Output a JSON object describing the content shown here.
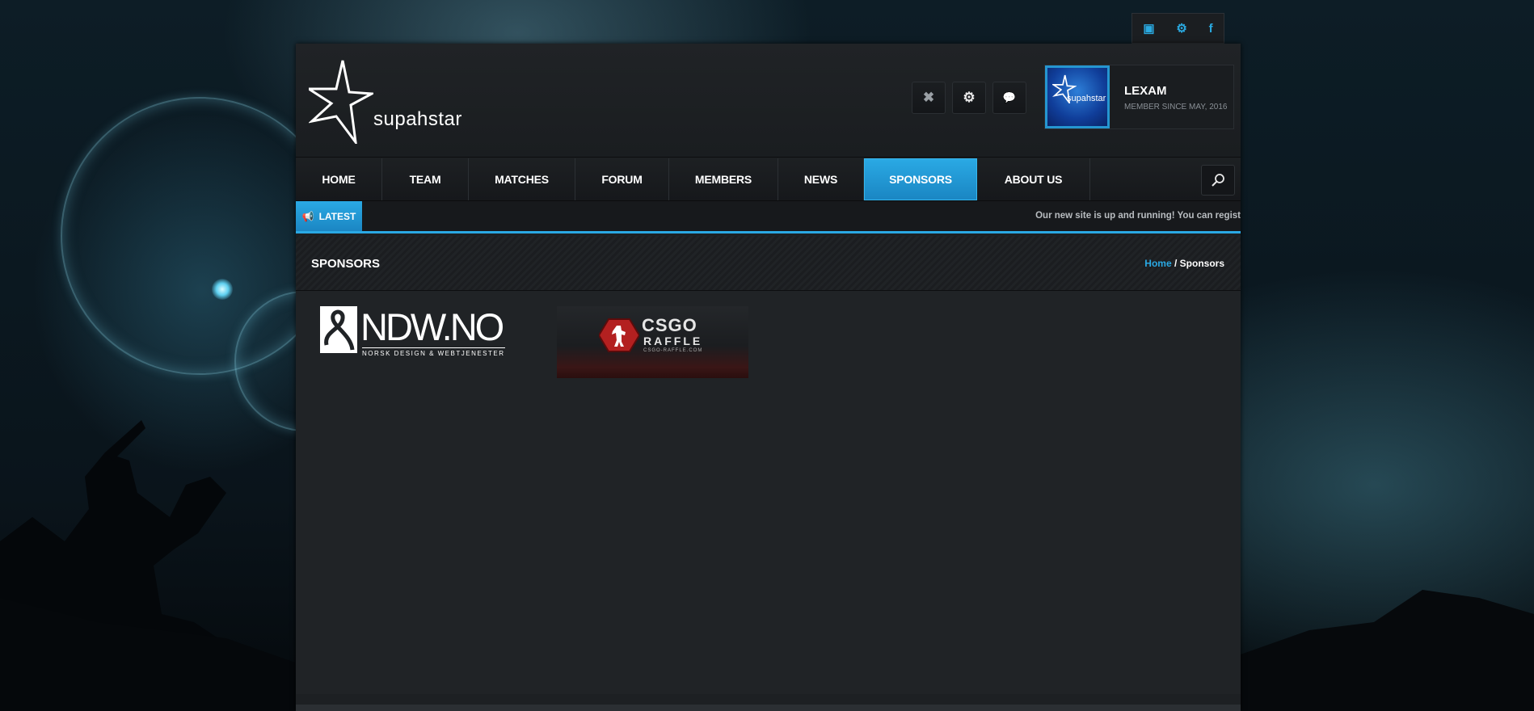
{
  "social": {
    "items": [
      {
        "icon": "twitch-icon",
        "glyph": "▣"
      },
      {
        "icon": "steam-icon",
        "glyph": "⚙"
      },
      {
        "icon": "facebook-icon",
        "glyph": "f"
      }
    ]
  },
  "header": {
    "logo_text": "supahstar",
    "buttons": [
      {
        "icon": "close-icon",
        "glyph": "✖"
      },
      {
        "icon": "settings-icon",
        "glyph": "⚙"
      },
      {
        "icon": "chat-icon",
        "glyph": "💬"
      }
    ],
    "user": {
      "avatar_text": "supahstar",
      "name": "LEXAM",
      "since": "MEMBER SINCE MAY, 2016"
    }
  },
  "nav": {
    "items": [
      "HOME",
      "TEAM",
      "MATCHES",
      "FORUM",
      "MEMBERS",
      "NEWS",
      "SPONSORS",
      "ABOUT US"
    ],
    "active": "SPONSORS"
  },
  "latest": {
    "label": "LATEST",
    "ticker": "Our new site is up and running! You can regist"
  },
  "page": {
    "title": "SPONSORS",
    "breadcrumb_home": "Home",
    "breadcrumb_sep": " / ",
    "breadcrumb_current": "Sponsors"
  },
  "sponsors": {
    "ndw": {
      "name": "NDW.NO",
      "tagline": "NORSK DESIGN & WEBTJENESTER"
    },
    "csgo": {
      "title": "CSGO",
      "sub": "RAFFLE",
      "url": "CSGO-RAFFLE.COM"
    }
  },
  "colors": {
    "accent": "#2aa9e4",
    "panel": "#1d2023"
  }
}
